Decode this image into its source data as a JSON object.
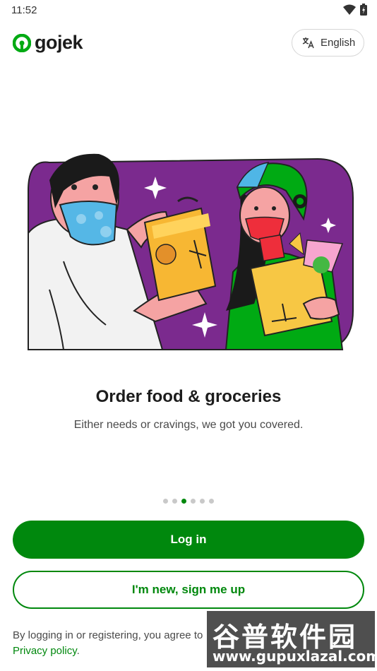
{
  "status_bar": {
    "time": "11:52",
    "wifi_icon": "wifi-icon",
    "battery_icon": "battery-charging-icon"
  },
  "header": {
    "logo_text": "gojek",
    "logo_icon": "gojek-logo-icon",
    "language_button": {
      "label": "English",
      "icon": "translate-icon"
    }
  },
  "onboarding": {
    "title": "Order food & groceries",
    "subtitle": "Either needs or cravings, we got you covered.",
    "pagination": {
      "total": 6,
      "active_index": 2
    },
    "hero_icon": "food-delivery-illustration"
  },
  "actions": {
    "login_label": "Log in",
    "signup_label": "I'm new, sign me up"
  },
  "legal": {
    "text_before": "By logging in or registering, you agree to",
    "privacy_link": "Privacy policy",
    "text_after": "."
  },
  "watermark": {
    "text_cn": "谷普软件园",
    "url": "www.gupuxlazal.com"
  },
  "colors": {
    "brand_green": "#00880d",
    "hero_purple": "#7b2a8e"
  }
}
